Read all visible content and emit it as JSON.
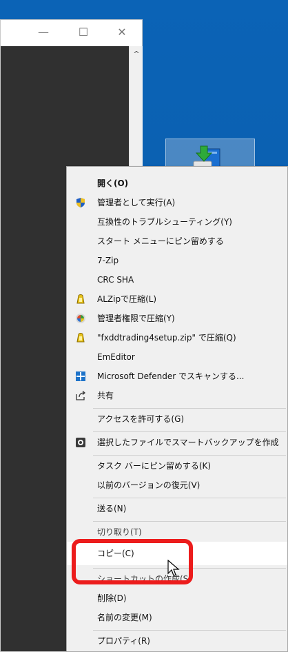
{
  "window": {
    "minimize_glyph": "—",
    "maximize_glyph": "☐",
    "close_glyph": "✕",
    "scroll_up_glyph": "^"
  },
  "desktop_icon": {
    "icon": "installer-icon"
  },
  "menu": {
    "items": [
      {
        "label": "開く(O)",
        "icon": ""
      },
      {
        "label": "管理者として実行(A)",
        "icon": "uac-shield-icon"
      },
      {
        "label": "互換性のトラブルシューティング(Y)",
        "icon": ""
      },
      {
        "label": "スタート メニューにピン留めする",
        "icon": ""
      },
      {
        "label": "7-Zip",
        "icon": ""
      },
      {
        "label": "CRC SHA",
        "icon": ""
      },
      {
        "label": "ALZipで圧縮(L)",
        "icon": "alzip-icon"
      },
      {
        "label": "管理者権限で圧縮(Y)",
        "icon": "alzip-admin-icon"
      },
      {
        "label": "\"fxddtrading4setup.zip\" で圧縮(Q)",
        "icon": "alzip-icon"
      },
      {
        "label": "EmEditor",
        "icon": ""
      },
      {
        "label": "Microsoft Defender でスキャンする...",
        "icon": "defender-icon"
      },
      {
        "label": "共有",
        "icon": "share-icon"
      },
      {
        "label": "アクセスを許可する(G)",
        "icon": ""
      },
      {
        "label": "選択したファイルでスマートバックアップを作成",
        "icon": "backup-icon"
      },
      {
        "label": "タスク バーにピン留めする(K)",
        "icon": ""
      },
      {
        "label": "以前のバージョンの復元(V)",
        "icon": ""
      },
      {
        "label": "送る(N)",
        "icon": ""
      },
      {
        "label": "切り取り(T)",
        "icon": ""
      },
      {
        "label": "コピー(C)",
        "icon": ""
      },
      {
        "label": "ショートカットの作成(S)",
        "icon": ""
      },
      {
        "label": "削除(D)",
        "icon": ""
      },
      {
        "label": "名前の変更(M)",
        "icon": ""
      },
      {
        "label": "プロパティ(R)",
        "icon": ""
      }
    ]
  },
  "colors": {
    "desktop": "#0b5fb0",
    "highlight": "#ec1c1c",
    "menu_bg": "#f0f0f0"
  }
}
